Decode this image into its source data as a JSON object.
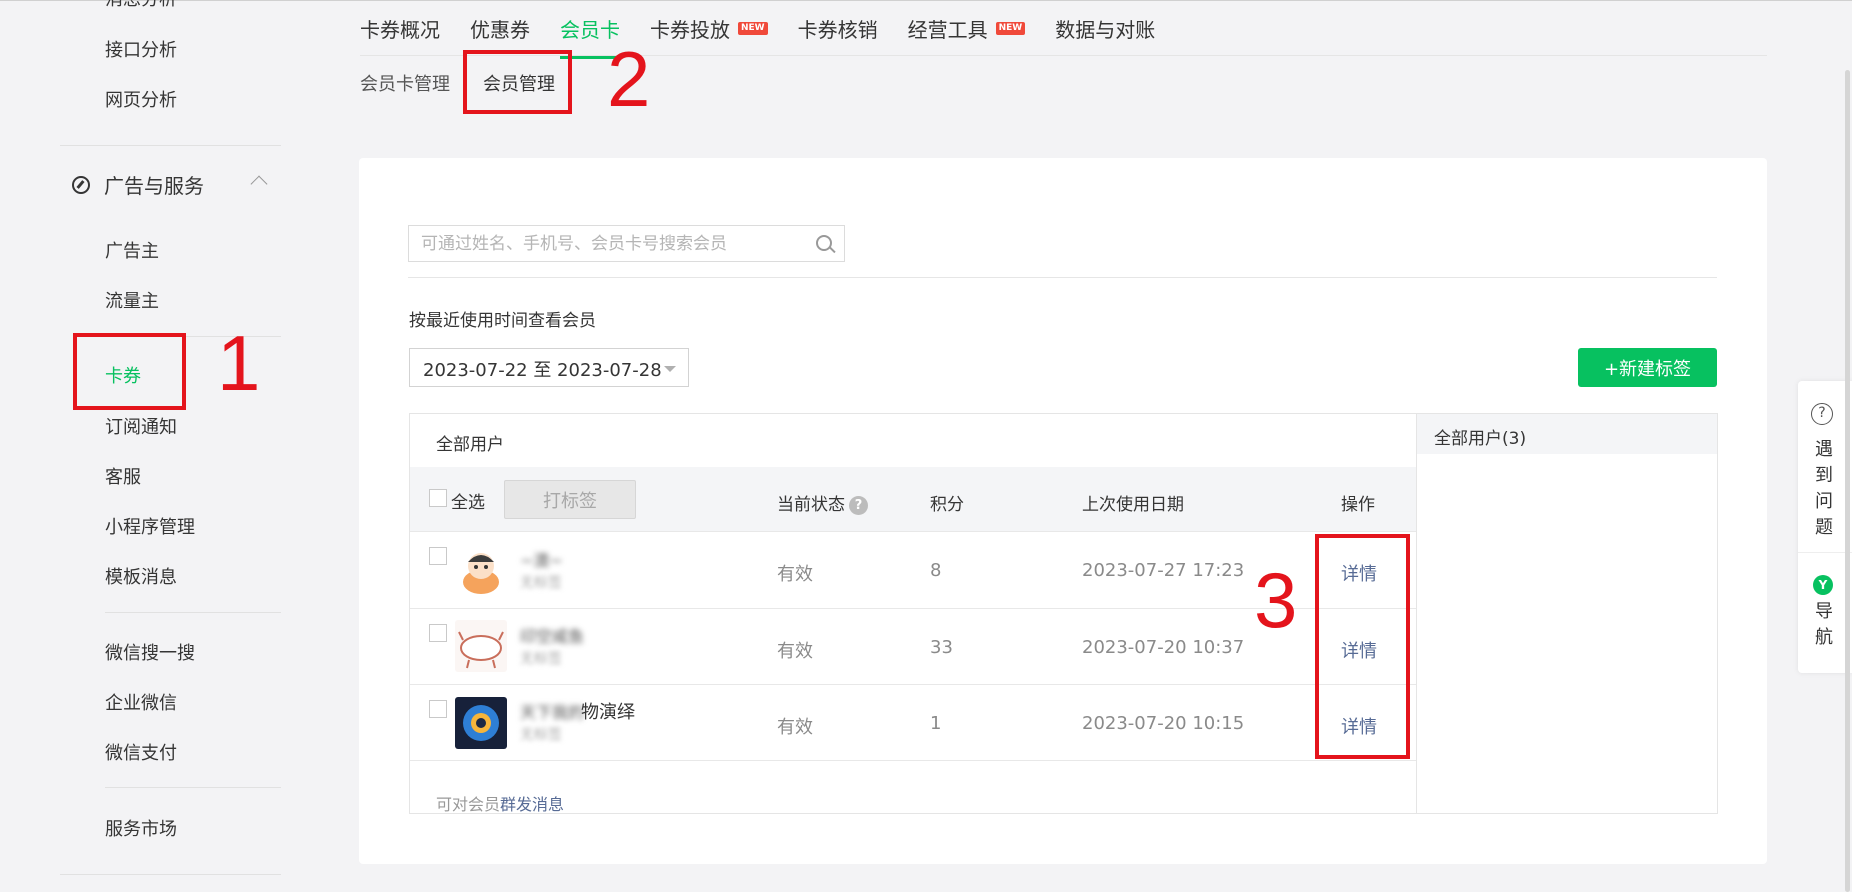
{
  "sidebar": {
    "partial_top": "消息分析",
    "items_top": [
      "接口分析",
      "网页分析"
    ],
    "section": {
      "label": "广告与服务",
      "expanded": true
    },
    "section_items": [
      "广告主",
      "流量主"
    ],
    "items_mid": [
      "卡券",
      "订阅通知",
      "客服",
      "小程序管理",
      "模板消息"
    ],
    "items_lower": [
      "微信搜一搜",
      "企业微信",
      "微信支付"
    ],
    "items_bottom": [
      "服务市场"
    ],
    "active": "卡券"
  },
  "top_tabs": [
    {
      "label": "卡券概况",
      "active": false,
      "new": false
    },
    {
      "label": "优惠券",
      "active": false,
      "new": false
    },
    {
      "label": "会员卡",
      "active": true,
      "new": false
    },
    {
      "label": "卡券投放",
      "active": false,
      "new": true
    },
    {
      "label": "卡券核销",
      "active": false,
      "new": false
    },
    {
      "label": "经营工具",
      "active": false,
      "new": true
    },
    {
      "label": "数据与对账",
      "active": false,
      "new": false
    }
  ],
  "new_badge_text": "NEW",
  "sub_tabs": [
    {
      "label": "会员卡管理",
      "active": false
    },
    {
      "label": "会员管理",
      "active": true
    }
  ],
  "search": {
    "placeholder": "可通过姓名、手机号、会员卡号搜索会员",
    "value": ""
  },
  "filter": {
    "label": "按最近使用时间查看会员",
    "date_range": "2023-07-22 至 2023-07-28"
  },
  "new_tag_button": "+新建标签",
  "table": {
    "title": "全部用户",
    "select_all": "全选",
    "tag_button": "打标签",
    "columns": {
      "status": "当前状态",
      "points": "积分",
      "last_used": "上次使用日期",
      "action": "操作"
    },
    "help_glyph": "?",
    "rows": [
      {
        "nickname": "~澳~",
        "tag": "无标签",
        "status": "有效",
        "points": "8",
        "last_used": "2023-07-27 17:23",
        "action": "详情"
      },
      {
        "nickname": "印空咸鱼",
        "tag": "无标签",
        "status": "有效",
        "points": "33",
        "last_used": "2023-07-20 10:37",
        "action": "详情"
      },
      {
        "nickname": "天下我的",
        "nickname_visible": "物演绎",
        "tag": "无标签",
        "status": "有效",
        "points": "1",
        "last_used": "2023-07-20 10:15",
        "action": "详情"
      }
    ],
    "footer_prefix": "可对会员",
    "footer_link": "群发消息"
  },
  "right_panel": {
    "title": "全部用户(3)"
  },
  "float_help": {
    "icon": "?",
    "label": "遇到问题",
    "nav_icon": "Y",
    "nav_label": "导航"
  },
  "annotations": [
    "1",
    "2",
    "3"
  ],
  "colors": {
    "accent": "#07c160",
    "annotation_red": "#e4141c",
    "link": "#576b95",
    "badge": "#f0493a"
  }
}
